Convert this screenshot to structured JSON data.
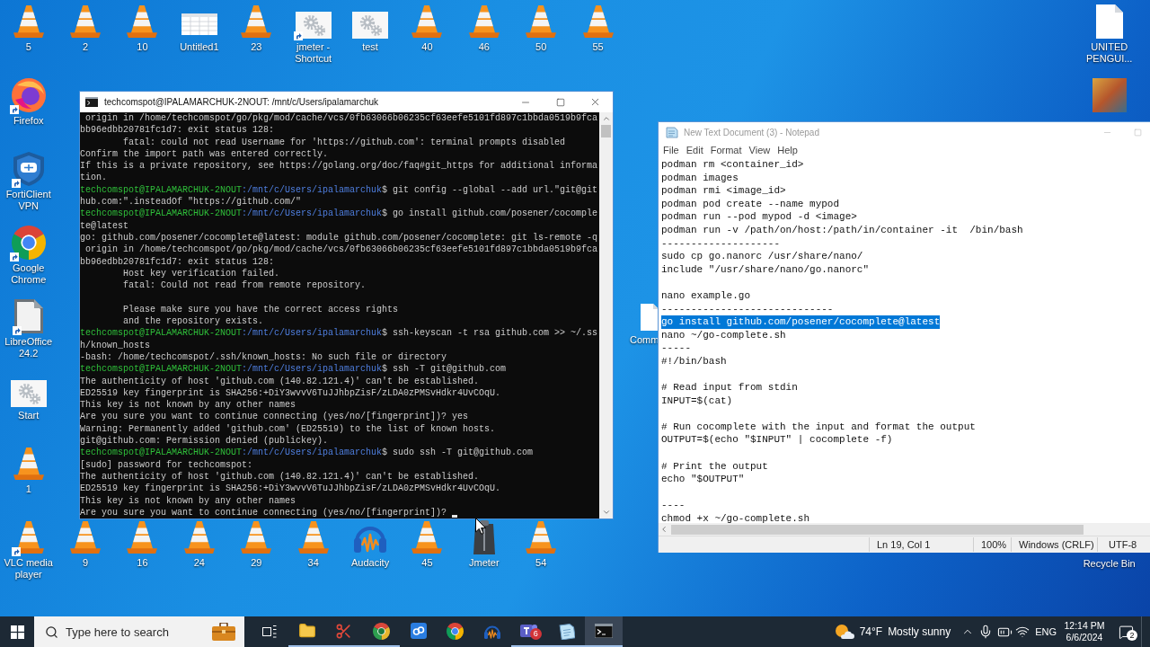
{
  "desktop": {
    "top_row": [
      {
        "label": "5",
        "kind": "vlc",
        "shortcut": false
      },
      {
        "label": "2",
        "kind": "vlc",
        "shortcut": false
      },
      {
        "label": "10",
        "kind": "vlc",
        "shortcut": false
      },
      {
        "label": "Untitled1",
        "kind": "sheet",
        "shortcut": false
      },
      {
        "label": "23",
        "kind": "vlc",
        "shortcut": false
      },
      {
        "label": "jmeter - Shortcut",
        "kind": "gears",
        "shortcut": true
      },
      {
        "label": "test",
        "kind": "gears",
        "shortcut": false
      },
      {
        "label": "40",
        "kind": "vlc",
        "shortcut": false
      },
      {
        "label": "46",
        "kind": "vlc",
        "shortcut": false
      },
      {
        "label": "50",
        "kind": "vlc",
        "shortcut": false
      },
      {
        "label": "55",
        "kind": "vlc",
        "shortcut": false
      }
    ],
    "left_column": [
      {
        "label": "Firefox",
        "kind": "firefox",
        "shortcut": true
      },
      {
        "label": "FortiClient VPN",
        "kind": "shield",
        "shortcut": true
      },
      {
        "label": "Google Chrome",
        "kind": "chrome",
        "shortcut": true
      },
      {
        "label": "LibreOffice 24.2",
        "kind": "libreoffice",
        "shortcut": true
      },
      {
        "label": "Start",
        "kind": "gears",
        "shortcut": false
      },
      {
        "label": "1",
        "kind": "vlc",
        "shortcut": false
      }
    ],
    "bottom_row": [
      {
        "label": "VLC media player",
        "kind": "vlc",
        "shortcut": true
      },
      {
        "label": "9",
        "kind": "vlc",
        "shortcut": false
      },
      {
        "label": "16",
        "kind": "vlc",
        "shortcut": false
      },
      {
        "label": "24",
        "kind": "vlc",
        "shortcut": false
      },
      {
        "label": "29",
        "kind": "vlc",
        "shortcut": false
      },
      {
        "label": "34",
        "kind": "vlc",
        "shortcut": false
      },
      {
        "label": "Audacity",
        "kind": "audacity",
        "shortcut": false
      },
      {
        "label": "45",
        "kind": "vlc",
        "shortcut": false
      },
      {
        "label": "Jmeter",
        "kind": "jmeter",
        "shortcut": false
      },
      {
        "label": "54",
        "kind": "vlc",
        "shortcut": false
      }
    ],
    "right_column": [
      {
        "label": "UNITED PENGUI...",
        "kind": "document",
        "shortcut": false
      },
      {
        "kind": "photo",
        "shortcut": false
      }
    ],
    "partly_hidden": [
      {
        "label": "Comm",
        "kind": "document"
      }
    ],
    "recycle_bin": {
      "label": "Recycle Bin"
    }
  },
  "terminal": {
    "title": "techcomspot@IPALAMARCHUK-2NOUT: /mnt/c/Users/ipalamarchuk",
    "active": true,
    "cursor_visible": true,
    "lines": [
      {
        "kind": "output",
        "text": " origin in /home/techcomspot/go/pkg/mod/cache/vcs/0fb63066b06235cf63eefe5101fd897c1bbda0519b9fca"
      },
      {
        "kind": "output",
        "text": "bb96edbb20781fc1d7: exit status 128:"
      },
      {
        "kind": "output",
        "text": "        fatal: could not read Username for 'https://github.com': terminal prompts disabled"
      },
      {
        "kind": "output",
        "text": "Confirm the import path was entered correctly."
      },
      {
        "kind": "output",
        "text": "If this is a private repository, see https://golang.org/doc/faq#git_https for additional informa"
      },
      {
        "kind": "output",
        "text": "tion."
      },
      {
        "kind": "prompt",
        "user": "techcomspot@IPALAMARCHUK-2NOUT",
        "path": ":/mnt/c/Users/ipalamarchuk",
        "command": "$ git config --global --add url.\"git@git"
      },
      {
        "kind": "output",
        "text": "hub.com:\".insteadOf \"https://github.com/\""
      },
      {
        "kind": "prompt",
        "user": "techcomspot@IPALAMARCHUK-2NOUT",
        "path": ":/mnt/c/Users/ipalamarchuk",
        "command": "$ go install github.com/posener/cocomple"
      },
      {
        "kind": "output",
        "text": "te@latest"
      },
      {
        "kind": "output",
        "text": "go: github.com/posener/cocomplete@latest: module github.com/posener/cocomplete: git ls-remote -q"
      },
      {
        "kind": "output",
        "text": " origin in /home/techcomspot/go/pkg/mod/cache/vcs/0fb63066b06235cf63eefe5101fd897c1bbda0519b9fca"
      },
      {
        "kind": "output",
        "text": "bb96edbb20781fc1d7: exit status 128:"
      },
      {
        "kind": "output",
        "text": "        Host key verification failed."
      },
      {
        "kind": "output",
        "text": "        fatal: Could not read from remote repository."
      },
      {
        "kind": "blank"
      },
      {
        "kind": "output",
        "text": "        Please make sure you have the correct access rights"
      },
      {
        "kind": "output",
        "text": "        and the repository exists."
      },
      {
        "kind": "prompt",
        "user": "techcomspot@IPALAMARCHUK-2NOUT",
        "path": ":/mnt/c/Users/ipalamarchuk",
        "command": "$ ssh-keyscan -t rsa github.com >> ~/.ss"
      },
      {
        "kind": "output",
        "text": "h/known_hosts"
      },
      {
        "kind": "output",
        "text": "-bash: /home/techcomspot/.ssh/known_hosts: No such file or directory"
      },
      {
        "kind": "prompt",
        "user": "techcomspot@IPALAMARCHUK-2NOUT",
        "path": ":/mnt/c/Users/ipalamarchuk",
        "command": "$ ssh -T git@github.com"
      },
      {
        "kind": "output",
        "text": "The authenticity of host 'github.com (140.82.121.4)' can't be established."
      },
      {
        "kind": "output",
        "text": "ED25519 key fingerprint is SHA256:+DiY3wvvV6TuJJhbpZisF/zLDA0zPMSvHdkr4UvCOqU."
      },
      {
        "kind": "output",
        "text": "This key is not known by any other names"
      },
      {
        "kind": "output",
        "text": "Are you sure you want to continue connecting (yes/no/[fingerprint])? yes"
      },
      {
        "kind": "output",
        "text": "Warning: Permanently added 'github.com' (ED25519) to the list of known hosts."
      },
      {
        "kind": "output",
        "text": "git@github.com: Permission denied (publickey)."
      },
      {
        "kind": "prompt",
        "user": "techcomspot@IPALAMARCHUK-2NOUT",
        "path": ":/mnt/c/Users/ipalamarchuk",
        "command": "$ sudo ssh -T git@github.com"
      },
      {
        "kind": "output",
        "text": "[sudo] password for techcomspot:"
      },
      {
        "kind": "output",
        "text": "The authenticity of host 'github.com (140.82.121.4)' can't be established."
      },
      {
        "kind": "output",
        "text": "ED25519 key fingerprint is SHA256:+DiY3wvvV6TuJJhbpZisF/zLDA0zPMSvHdkr4UvCOqU."
      },
      {
        "kind": "output",
        "text": "This key is not known by any other names"
      },
      {
        "kind": "output",
        "text": "Are you sure you want to continue connecting (yes/no/[fingerprint])?"
      }
    ]
  },
  "notepad": {
    "title": "New Text Document (3) - Notepad",
    "active": false,
    "menu": [
      "File",
      "Edit",
      "Format",
      "View",
      "Help"
    ],
    "lines": [
      {
        "kind": "text",
        "text": "podman rm <container_id>",
        "selected": false
      },
      {
        "kind": "text",
        "text": "podman images",
        "selected": false
      },
      {
        "kind": "text",
        "text": "podman rmi <image_id>",
        "selected": false
      },
      {
        "kind": "text",
        "text": "podman pod create --name mypod",
        "selected": false
      },
      {
        "kind": "text",
        "text": "podman run --pod mypod -d <image>",
        "selected": false
      },
      {
        "kind": "text",
        "text": "podman run -v /path/on/host:/path/in/container -it  /bin/bash",
        "selected": false
      },
      {
        "kind": "text",
        "text": "--------------------",
        "selected": false
      },
      {
        "kind": "text",
        "text": "sudo cp go.nanorc /usr/share/nano/",
        "selected": false
      },
      {
        "kind": "text",
        "text": "include \"/usr/share/nano/go.nanorc\"",
        "selected": false
      },
      {
        "kind": "blank",
        "selected": false
      },
      {
        "kind": "text",
        "text": "nano example.go",
        "selected": false
      },
      {
        "kind": "text",
        "text": "-----------------------------",
        "selected": false
      },
      {
        "kind": "text",
        "text": "go install github.com/posener/cocomplete@latest",
        "selected": true
      },
      {
        "kind": "text",
        "text": "nano ~/go-complete.sh",
        "selected": false
      },
      {
        "kind": "text",
        "text": "-----",
        "selected": false
      },
      {
        "kind": "text",
        "text": "#!/bin/bash",
        "selected": false
      },
      {
        "kind": "blank",
        "selected": false
      },
      {
        "kind": "text",
        "text": "# Read input from stdin",
        "selected": false
      },
      {
        "kind": "text",
        "text": "INPUT=$(cat)",
        "selected": false
      },
      {
        "kind": "blank",
        "selected": false
      },
      {
        "kind": "text",
        "text": "# Run cocomplete with the input and format the output",
        "selected": false
      },
      {
        "kind": "text",
        "text": "OUTPUT=$(echo \"$INPUT\" | cocomplete -f)",
        "selected": false
      },
      {
        "kind": "blank",
        "selected": false
      },
      {
        "kind": "text",
        "text": "# Print the output",
        "selected": false
      },
      {
        "kind": "text",
        "text": "echo \"$OUTPUT\"",
        "selected": false
      },
      {
        "kind": "blank",
        "selected": false
      },
      {
        "kind": "text",
        "text": "----",
        "selected": false
      },
      {
        "kind": "text",
        "text": "chmod +x ~/go-complete.sh",
        "selected": false
      }
    ],
    "status_bar": {
      "position": "Ln 19, Col 1",
      "zoom": "100%",
      "line_ending": "Windows (CRLF)",
      "encoding": "UTF-8"
    }
  },
  "taskbar": {
    "search": {
      "placeholder": "Type here to search"
    },
    "apps": [
      {
        "kind": "explorer",
        "running": true,
        "active": false
      },
      {
        "kind": "scissors",
        "running": true,
        "active": false
      },
      {
        "kind": "canary",
        "running": true,
        "active": false
      },
      {
        "kind": "tile",
        "running": false,
        "active": false
      },
      {
        "kind": "chrome",
        "running": false,
        "active": false
      },
      {
        "kind": "headphones",
        "running": false,
        "active": false
      },
      {
        "kind": "teams",
        "badge": "6",
        "running": true,
        "active": false
      },
      {
        "kind": "notepad",
        "running": true,
        "active": false
      },
      {
        "kind": "terminal",
        "running": true,
        "active": true
      }
    ],
    "weather": {
      "temperature": "74°F",
      "condition": "Mostly sunny"
    },
    "language": "ENG",
    "time": "12:14 PM",
    "date": "6/6/2024",
    "notifications": "2"
  }
}
